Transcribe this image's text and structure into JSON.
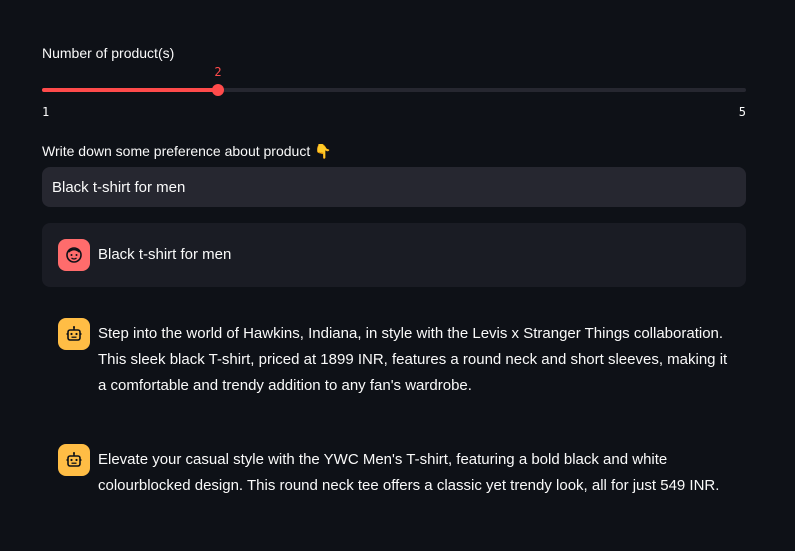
{
  "slider": {
    "label": "Number of product(s)",
    "min": 1,
    "max": 5,
    "value": 2,
    "min_label": "1",
    "max_label": "5",
    "value_label": "2",
    "accent_color": "#ff4b4b"
  },
  "preference_input": {
    "label": "Write down some preference about product 👇",
    "value": "Black t-shirt for men"
  },
  "chat": {
    "user_message": "Black t-shirt for men",
    "assistant_messages": [
      "Step into the world of Hawkins, Indiana, in style with the Levis x Stranger Things collaboration. This sleek black T-shirt, priced at 1899 INR, features a round neck and short sleeves, making it a comfortable and trendy addition to any fan's wardrobe.",
      "Elevate your casual style with the YWC Men's T-shirt, featuring a bold black and white colourblocked design. This round neck tee offers a classic yet trendy look, all for just 549 INR."
    ],
    "user_avatar_icon": "face-icon",
    "assistant_avatar_icon": "robot-icon",
    "user_avatar_color": "#ff6c6c",
    "assistant_avatar_color": "#ffbd45"
  }
}
